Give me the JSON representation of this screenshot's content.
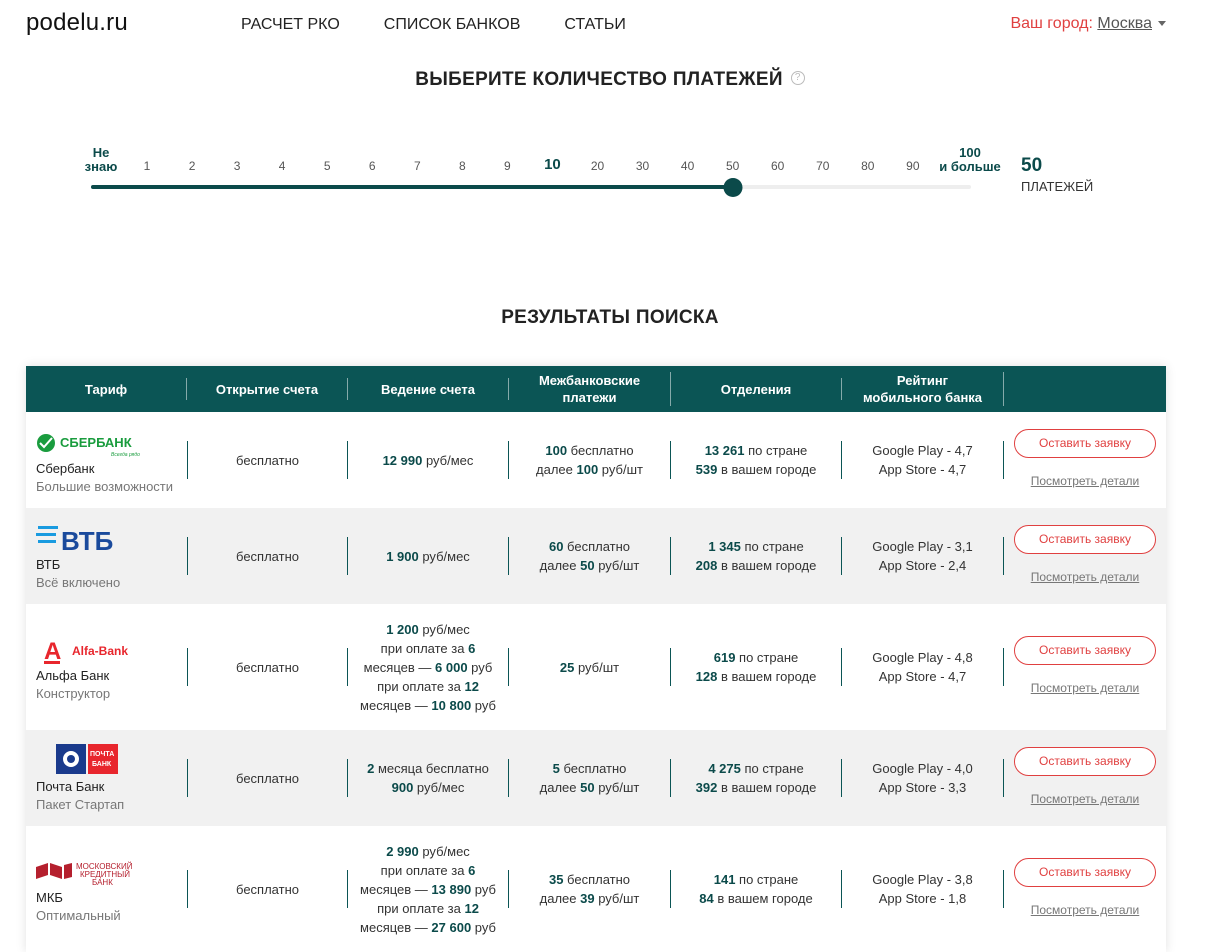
{
  "header": {
    "logo": "podelu.ru",
    "nav": [
      "РАСЧЕТ РКО",
      "СПИСОК БАНКОВ",
      "СТАТЬИ"
    ],
    "city_label": "Ваш город:",
    "city_value": "Москва"
  },
  "payments": {
    "title": "ВЫБЕРИТЕ КОЛИЧЕСТВО ПЛАТЕЖЕЙ",
    "help": "?",
    "ticks": [
      "1",
      "2",
      "3",
      "4",
      "5",
      "6",
      "7",
      "8",
      "9",
      "10",
      "20",
      "30",
      "40",
      "50",
      "60",
      "70",
      "80",
      "90"
    ],
    "tick_first_line1": "Не",
    "tick_first_line2": "знаю",
    "tick_last_line1": "100",
    "tick_last_line2": "и больше",
    "selected_value": "50",
    "selected_unit": "ПЛАТЕЖЕЙ",
    "slider_fraction": 0.73
  },
  "results": {
    "title": "РЕЗУЛЬТАТЫ ПОИСКА",
    "headers": [
      "Тариф",
      "Открытие счета",
      "Ведение счета",
      "Межбанковские платежи",
      "Отделения",
      "Рейтинг мобильного банка",
      ""
    ],
    "apply_label": "Оставить заявку",
    "details_label": "Посмотреть детали",
    "rows": [
      {
        "bank": "Сбербанк",
        "tariff": "Большие возможности",
        "logo_text": "СБЕРБАНК",
        "logo_sub": "Всегда рядом",
        "logo_color": "#1a9c3e",
        "opening": "бесплатно",
        "maintenance_bold": "12 990",
        "maintenance": " руб/мес",
        "interbank_l1_bold": "100",
        "interbank_l1": " бесплатно",
        "interbank_l2a": "далее ",
        "interbank_l2_bold": "100",
        "interbank_l2": " руб/шт",
        "branches_country": "13 261",
        "branches_city": "539",
        "gp": "Google Play - 4,7",
        "as": "App Store - 4,7"
      },
      {
        "bank": "ВТБ",
        "tariff": "Всё включено",
        "logo_text": "ВТБ",
        "logo_color": "#1a4a9c",
        "opening": "бесплатно",
        "maintenance_bold": "1 900",
        "maintenance": " руб/мес",
        "interbank_l1_bold": "60",
        "interbank_l1": " бесплатно",
        "interbank_l2a": "далее ",
        "interbank_l2_bold": "50",
        "interbank_l2": " руб/шт",
        "branches_country": "1 345",
        "branches_city": "208",
        "gp": "Google Play - 3,1",
        "as": "App Store - 2,4"
      },
      {
        "bank": "Альфа Банк",
        "tariff": "Конструктор",
        "logo_text": "Alfa-Bank",
        "logo_color": "#e8262d",
        "opening": "бесплатно",
        "m_l1_bold": "1 200",
        "m_l1": " руб/мес",
        "m_l2": "при оплате за ",
        "m_l2_bold": "6",
        "m_l3a": "месяцев — ",
        "m_l3_bold": "6 000",
        "m_l3": " руб",
        "m_l4": "при оплате за ",
        "m_l4_bold": "12",
        "m_l5a": "месяцев — ",
        "m_l5_bold": "10 800",
        "m_l5": " руб",
        "interbank_bold": "25",
        "interbank": " руб/шт",
        "branches_country": "619",
        "branches_city": "128",
        "gp": "Google Play - 4,8",
        "as": "App Store - 4,7"
      },
      {
        "bank": "Почта Банк",
        "tariff": "Пакет Стартап",
        "logo_text": "ПОЧТА БАНК",
        "logo_color": "#e8262d",
        "opening": "бесплатно",
        "m_l1_bold": "2",
        "m_l1": " месяца бесплатно",
        "m_l2_bold": "900",
        "m_l2": " руб/мес",
        "interbank_l1_bold": "5",
        "interbank_l1": " бесплатно",
        "interbank_l2a": "далее ",
        "interbank_l2_bold": "50",
        "interbank_l2": " руб/шт",
        "branches_country": "4 275",
        "branches_city": "392",
        "gp": "Google Play - 4,0",
        "as": "App Store - 3,3"
      },
      {
        "bank": "МКБ",
        "tariff": "Оптимальный",
        "logo_text": "МОСКОВСКИЙ КРЕДИТНЫЙ БАНК",
        "logo_color": "#b5202e",
        "opening": "бесплатно",
        "m_l1_bold": "2 990",
        "m_l1": " руб/мес",
        "m_l2": "при оплате за ",
        "m_l2_bold": "6",
        "m_l3a": "месяцев — ",
        "m_l3_bold": "13 890",
        "m_l3": " руб",
        "m_l4": "при оплате за ",
        "m_l4_bold": "12",
        "m_l5a": "месяцев — ",
        "m_l5_bold": "27 600",
        "m_l5": " руб",
        "interbank_l1_bold": "35",
        "interbank_l1": " бесплатно",
        "interbank_l2a": "далее ",
        "interbank_l2_bold": "39",
        "interbank_l2": " руб/шт",
        "branches_country": "141",
        "branches_city": "84",
        "gp": "Google Play - 3,8",
        "as": "App Store - 1,8"
      }
    ],
    "suffix_country": " по стране",
    "suffix_city": " в вашем городе"
  }
}
